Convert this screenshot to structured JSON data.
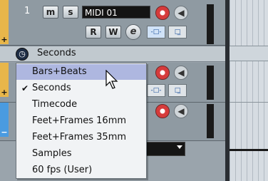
{
  "track1": {
    "number": "1",
    "mute_label": "m",
    "solo_label": "s",
    "name": "MIDI 01",
    "read_label": "R",
    "write_label": "W",
    "edit_label": "e"
  },
  "time_header": {
    "label": "Seconds",
    "clock_glyph": "◷"
  },
  "menu": {
    "items": [
      {
        "label": "Bars+Beats",
        "checked": false,
        "highlighted": true
      },
      {
        "label": "Seconds",
        "checked": true,
        "highlighted": false
      },
      {
        "label": "Timecode",
        "checked": false,
        "highlighted": false
      },
      {
        "label": "Feet+Frames 16mm",
        "checked": false,
        "highlighted": false
      },
      {
        "label": "Feet+Frames 35mm",
        "checked": false,
        "highlighted": false
      },
      {
        "label": "Samples",
        "checked": false,
        "highlighted": false
      },
      {
        "label": "60 fps (User)",
        "checked": false,
        "highlighted": false
      }
    ],
    "check_glyph": "✔"
  },
  "icons": {
    "plus": "+",
    "minus": "−",
    "speaker": "◀",
    "monitor_a": "-□-",
    "monitor_b": "□̲"
  },
  "colors": {
    "highlight": "#aeb7e0",
    "record": "#d63b3b",
    "track_color_1": "#e8b64a",
    "track_color_3": "#4a9be0"
  }
}
